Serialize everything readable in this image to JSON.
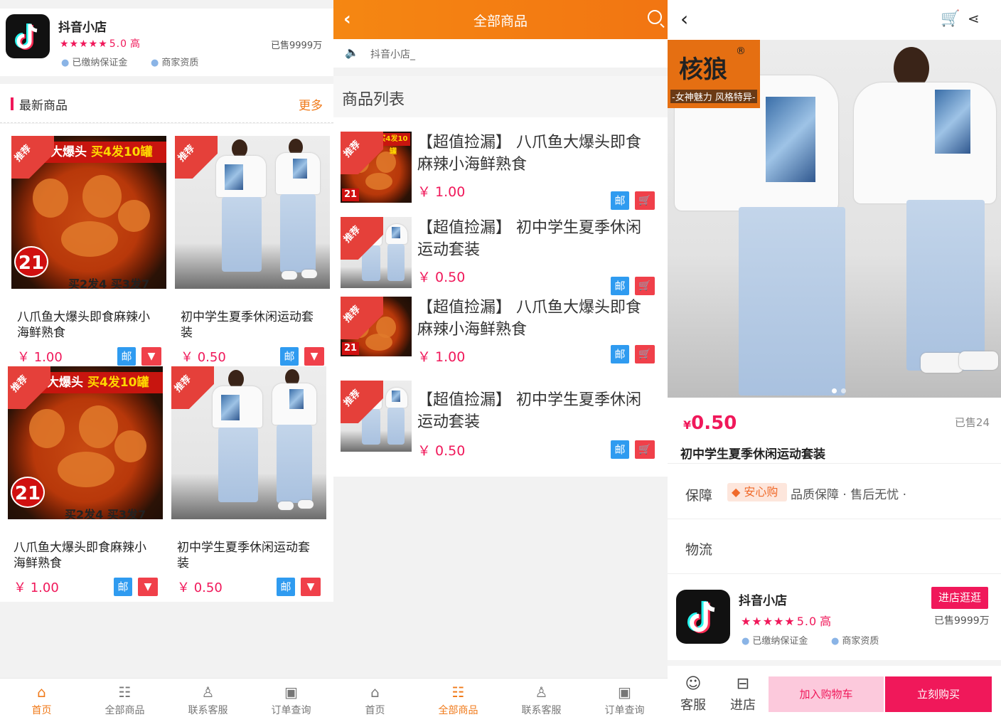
{
  "shop": {
    "name": "抖音小店",
    "stars": "★★★★★",
    "rating": "5.0",
    "level": "高",
    "deposit": "已缴纳保证金",
    "qualification": "商家资质",
    "sold": "已售9999万"
  },
  "latest": {
    "title": "最新商品",
    "more": "更多",
    "items": [
      {
        "title": "八爪鱼大爆头即食麻辣小海鲜熟食",
        "price": "￥ 1.00",
        "mail": "邮",
        "kind": "food"
      },
      {
        "title": "初中学生夏季休闲运动套装",
        "price": "￥ 0.50",
        "mail": "邮",
        "kind": "clothes"
      },
      {
        "title": "八爪鱼大爆头即食麻辣小海鲜熟食",
        "price": "￥ 1.00",
        "mail": "邮",
        "kind": "food"
      },
      {
        "title": "初中学生夏季休闲运动套装",
        "price": "￥ 0.50",
        "mail": "邮",
        "kind": "clothes"
      }
    ]
  },
  "food_image": {
    "banner_left": "鱼大爆头",
    "banner_right": "买4发10罐",
    "badge": "21",
    "foot": "买2发4 买3发7",
    "small_banner": "买4发10罐"
  },
  "clothes_image": {
    "tag": "风格特异"
  },
  "ribbon": "推荐",
  "tabbar": [
    {
      "label": "首页",
      "icon": "home-icon"
    },
    {
      "label": "全部商品",
      "icon": "list-icon"
    },
    {
      "label": "联系客服",
      "icon": "user-icon"
    },
    {
      "label": "订单查询",
      "icon": "wallet-icon"
    }
  ],
  "allgoods": {
    "title": "全部商品",
    "notice": "抖音小店_",
    "list_title": "商品列表",
    "items": [
      {
        "title": "【超值捡漏】 八爪鱼大爆头即食麻辣小海鲜熟食",
        "price": "￥ 1.00",
        "mail": "邮",
        "kind": "food"
      },
      {
        "title": "【超值捡漏】 初中学生夏季休闲运动套装",
        "price": "￥ 0.50",
        "mail": "邮",
        "kind": "clothes"
      },
      {
        "title": "【超值捡漏】 八爪鱼大爆头即食麻辣小海鲜熟食",
        "price": "￥ 1.00",
        "mail": "邮",
        "kind": "food"
      },
      {
        "title": "【超值捡漏】 初中学生夏季休闲运动套装",
        "price": "￥ 0.50",
        "mail": "邮",
        "kind": "clothes"
      }
    ]
  },
  "detail": {
    "brand_name": "核狼",
    "brand_mark": "®",
    "brand_slogan": "-女神魅力 风格特异-",
    "price_symbol": "¥",
    "price": "0.50",
    "sold": "已售24",
    "title": "初中学生夏季休闲运动套装",
    "guarantee_label": "保障",
    "guarantee_tag": "安心购",
    "guarantee_text": "品质保障 · 售后无忧 ·",
    "shipping_label": "物流",
    "enter_shop": "进店逛逛",
    "service": "客服",
    "shop": "进店",
    "add_cart": "加入购物车",
    "buy_now": "立刻购买"
  },
  "colors": {
    "accent": "#f0185a",
    "orange": "#f07a1a",
    "mail_blue": "#2f9bf0",
    "cart_red": "#f0404a"
  }
}
